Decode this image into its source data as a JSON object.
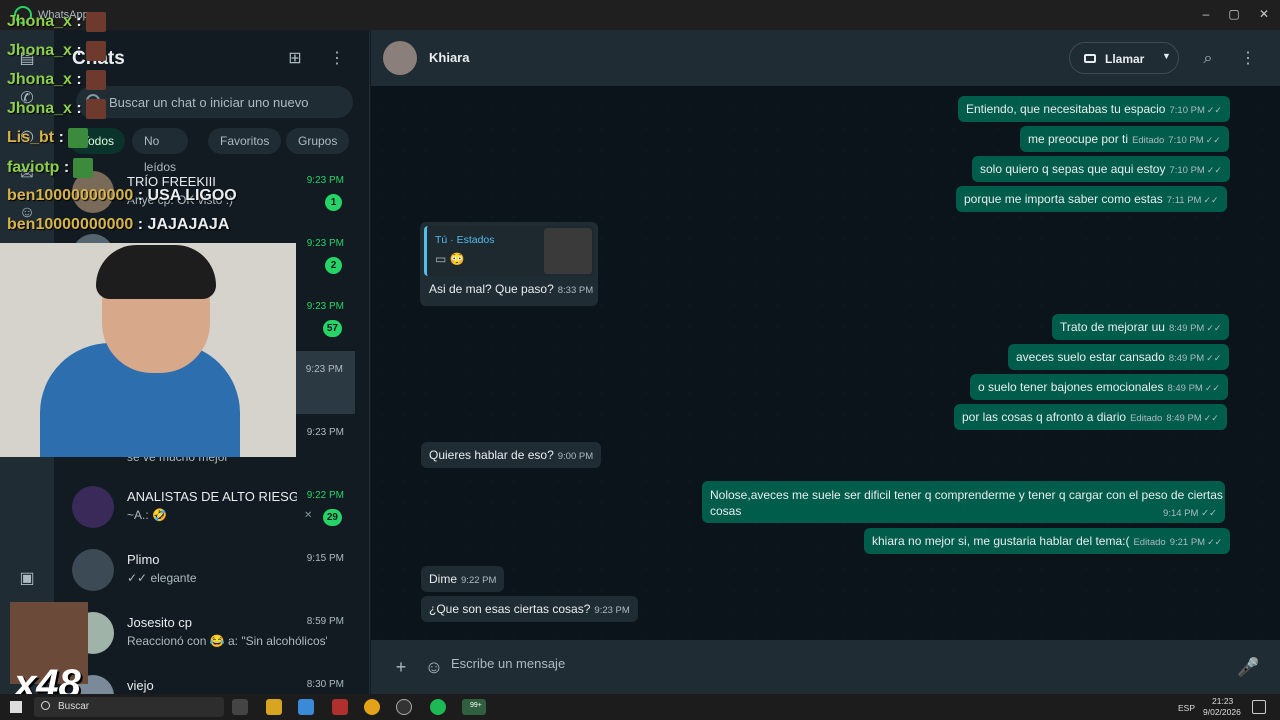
{
  "window": {
    "title": "WhatsApp",
    "controls": [
      "–",
      "▢",
      "✕"
    ]
  },
  "chatlist": {
    "title": "Chats",
    "search_placeholder": "Buscar un chat o iniciar uno nuevo",
    "filters": [
      "Todos",
      "No leídos",
      "Favoritos",
      "Grupos"
    ],
    "chats": [
      {
        "name": "TRÍO FREEKIII",
        "preview": "Anye cp: OK visto :)",
        "time": "9:23 PM",
        "badge": "1"
      },
      {
        "name": "",
        "preview": "",
        "time": "9:23 PM",
        "badge": "2"
      },
      {
        "name": "",
        "preview": "",
        "time": "9:23 PM",
        "badge": "57"
      },
      {
        "name": "",
        "preview": "",
        "time": "9:23 PM",
        "badge": ""
      },
      {
        "name": "",
        "preview": "se ve mucho mejor",
        "time": "9:23 PM",
        "badge": ""
      },
      {
        "name": "ANALISTAS DE ALTO RIESG...",
        "preview": "~A.: 🤣",
        "time": "9:22 PM",
        "badge": "29"
      },
      {
        "name": "Plimo",
        "preview": "✓✓ elegante",
        "time": "9:15 PM",
        "badge": ""
      },
      {
        "name": "Josesito cp",
        "preview": "Reaccionó con 😂 a: \"Sin alcohólicos\"",
        "time": "8:59 PM",
        "badge": ""
      },
      {
        "name": "viejo",
        "preview": "",
        "time": "8:30 PM",
        "badge": ""
      }
    ]
  },
  "conversation": {
    "contact_name": "Khiara",
    "call_label": "Llamar",
    "messages": [
      {
        "dir": "out",
        "text": "Entiendo, que necesitabas tu espacio",
        "edited": "",
        "time": "7:10 PM"
      },
      {
        "dir": "out",
        "text": "me preocupe por ti",
        "edited": "Editado",
        "time": "7:10 PM"
      },
      {
        "dir": "out",
        "text": "solo quiero q sepas que aqui estoy",
        "edited": "",
        "time": "7:10 PM"
      },
      {
        "dir": "out",
        "text": "porque me importa saber como estas",
        "edited": "",
        "time": "7:11 PM"
      },
      {
        "dir": "in",
        "text": "Asi de mal? Que paso?",
        "edited": "",
        "time": "8:33 PM"
      },
      {
        "dir": "out",
        "text": "Trato de mejorar uu",
        "edited": "",
        "time": "8:49 PM"
      },
      {
        "dir": "out",
        "text": "aveces suelo estar cansado",
        "edited": "",
        "time": "8:49 PM"
      },
      {
        "dir": "out",
        "text": "o suelo tener bajones emocionales",
        "edited": "",
        "time": "8:49 PM"
      },
      {
        "dir": "out",
        "text": "por las cosas q afronto a diario",
        "edited": "Editado",
        "time": "8:49 PM"
      },
      {
        "dir": "in",
        "text": "Quieres hablar de eso?",
        "edited": "",
        "time": "9:00 PM"
      },
      {
        "dir": "out",
        "text": "Nolose,aveces me suele ser dificil tener q comprenderme y tener q cargar con el peso de ciertas cosas",
        "edited": "",
        "time": "9:14 PM"
      },
      {
        "dir": "out",
        "text": "khiara no mejor si, me gustaria hablar del tema:(",
        "edited": "Editado",
        "time": "9:21 PM"
      },
      {
        "dir": "in",
        "text": "Dime",
        "edited": "",
        "time": "9:22 PM"
      },
      {
        "dir": "in",
        "text": "¿Que son esas ciertas cosas?",
        "edited": "",
        "time": "9:23 PM"
      }
    ],
    "quote": {
      "title": "Tú · Estados",
      "emoji": "😳"
    },
    "composer_placeholder": "Escribe un mensaje"
  },
  "taskbar": {
    "search_label": "Buscar",
    "wa_badge": "99+",
    "lang": "ESP",
    "time": "21:23",
    "date": "9/02/2026"
  },
  "overlay": {
    "lines": [
      {
        "user": "Jhona_x",
        "text": ":"
      },
      {
        "user": "Jhona_x",
        "text": ":"
      },
      {
        "user": "Jhona_x",
        "text": ":"
      },
      {
        "user": "Jhona_x",
        "text": ":"
      },
      {
        "user": "Lis_bt",
        "text": ":"
      },
      {
        "user": "faviotp",
        "text": ":"
      },
      {
        "user": "ben10000000000",
        "text": ": USA LIGOO"
      },
      {
        "user": "ben10000000000",
        "text": ": JAJAJAJA"
      }
    ],
    "multiplier": "x48"
  },
  "colors": {
    "outgoing_bubble": "#005c4b",
    "incoming_bubble": "#202c33",
    "accent": "#25d366",
    "background": "#0b141a"
  }
}
